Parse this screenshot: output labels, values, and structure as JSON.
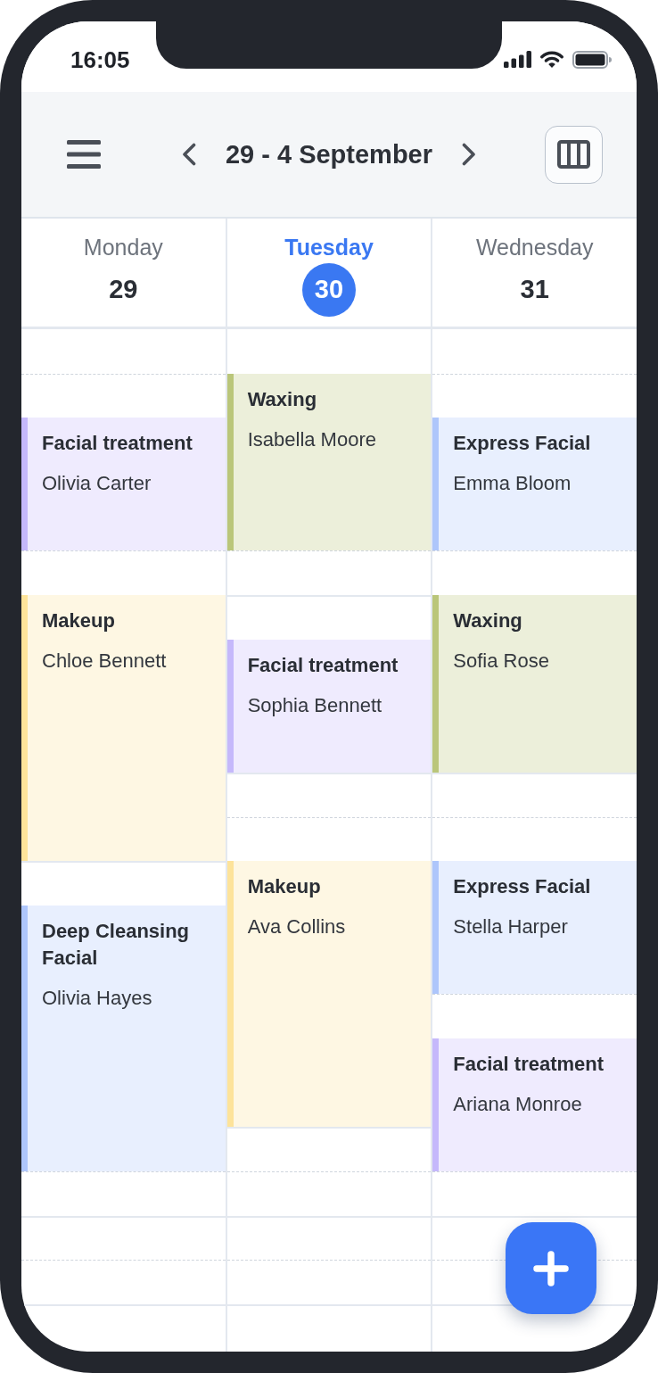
{
  "status_bar": {
    "time": "16:05"
  },
  "header": {
    "title": "29 - 4 September"
  },
  "days": [
    {
      "name": "Monday",
      "date": "29",
      "selected": false,
      "slots": [
        {
          "kind": "free"
        },
        {
          "kind": "free"
        },
        {
          "kind": "event",
          "title": "Facial treatment",
          "client": "Olivia Carter",
          "color": "#c5b8fb"
        },
        {
          "kind": "continued"
        },
        {
          "kind": "continued"
        },
        {
          "kind": "free"
        },
        {
          "kind": "event",
          "title": "Makeup",
          "client": "Chloe Bennett",
          "color": "#fde39a"
        },
        {
          "kind": "continued"
        },
        {
          "kind": "continued"
        },
        {
          "kind": "continued"
        },
        {
          "kind": "continued"
        },
        {
          "kind": "continued"
        },
        {
          "kind": "free"
        },
        {
          "kind": "event",
          "title": "Deep Cleansing Facial",
          "client": "Olivia Hayes",
          "color": "#aec6fb"
        },
        {
          "kind": "continued"
        },
        {
          "kind": "continued"
        },
        {
          "kind": "continued"
        },
        {
          "kind": "continued"
        },
        {
          "kind": "continued"
        },
        {
          "kind": "free"
        },
        {
          "kind": "free"
        },
        {
          "kind": "free"
        },
        {
          "kind": "free"
        }
      ]
    },
    {
      "name": "Tuesday",
      "date": "30",
      "selected": true,
      "slots": [
        {
          "kind": "free"
        },
        {
          "kind": "event",
          "title": "Waxing",
          "client": "Isabella Moore",
          "color": "#bac67a"
        },
        {
          "kind": "continued"
        },
        {
          "kind": "continued"
        },
        {
          "kind": "continued"
        },
        {
          "kind": "free"
        },
        {
          "kind": "free"
        },
        {
          "kind": "event",
          "title": "Facial treatment",
          "client": "Sophia Bennett",
          "color": "#c5b8fb"
        },
        {
          "kind": "continued"
        },
        {
          "kind": "continued"
        },
        {
          "kind": "free"
        },
        {
          "kind": "free"
        },
        {
          "kind": "event",
          "title": "Makeup",
          "client": "Ava Collins",
          "color": "#fde39a"
        },
        {
          "kind": "continued"
        },
        {
          "kind": "continued"
        },
        {
          "kind": "continued"
        },
        {
          "kind": "continued"
        },
        {
          "kind": "continued"
        },
        {
          "kind": "free"
        },
        {
          "kind": "free"
        },
        {
          "kind": "free"
        },
        {
          "kind": "free"
        },
        {
          "kind": "free"
        }
      ]
    },
    {
      "name": "Wednesday",
      "date": "31",
      "selected": false,
      "slots": [
        {
          "kind": "free"
        },
        {
          "kind": "free"
        },
        {
          "kind": "event",
          "title": "Express Facial",
          "client": "Emma Bloom",
          "color": "#aec6fb"
        },
        {
          "kind": "continued"
        },
        {
          "kind": "continued"
        },
        {
          "kind": "free"
        },
        {
          "kind": "event",
          "title": "Waxing",
          "client": "Sofia Rose",
          "color": "#bac67a"
        },
        {
          "kind": "continued"
        },
        {
          "kind": "continued"
        },
        {
          "kind": "continued"
        },
        {
          "kind": "free"
        },
        {
          "kind": "free"
        },
        {
          "kind": "event",
          "title": "Express Facial",
          "client": "Stella Harper",
          "color": "#aec6fb"
        },
        {
          "kind": "continued"
        },
        {
          "kind": "continued"
        },
        {
          "kind": "free"
        },
        {
          "kind": "event",
          "title": "Facial treatment",
          "client": "Ariana Monroe",
          "color": "#c5b8fb"
        },
        {
          "kind": "continued"
        },
        {
          "kind": "continued"
        },
        {
          "kind": "free"
        },
        {
          "kind": "free"
        },
        {
          "kind": "free"
        },
        {
          "kind": "free"
        }
      ]
    }
  ]
}
